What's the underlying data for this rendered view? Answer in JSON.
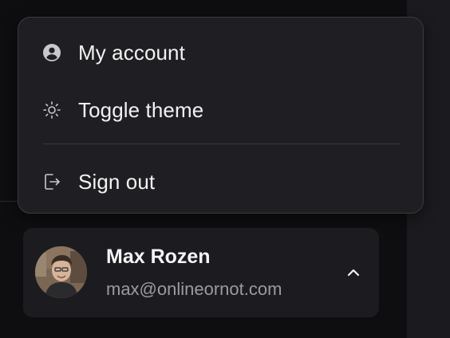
{
  "menu": {
    "items": [
      {
        "label": "My account",
        "icon": "account-circle-icon"
      },
      {
        "label": "Toggle theme",
        "icon": "sun-icon"
      },
      {
        "label": "Sign out",
        "icon": "sign-out-icon"
      }
    ]
  },
  "user": {
    "name": "Max Rozen",
    "email": "max@onlineornot.com",
    "chevron_icon": "chevron-up-icon"
  },
  "colors": {
    "background": "#0e0e10",
    "menu_background": "#1f1f23",
    "menu_border": "#3a3a3f",
    "card_background": "#1c1c20",
    "text_primary": "#f2f2f3",
    "text_secondary": "#9a9aa1"
  }
}
